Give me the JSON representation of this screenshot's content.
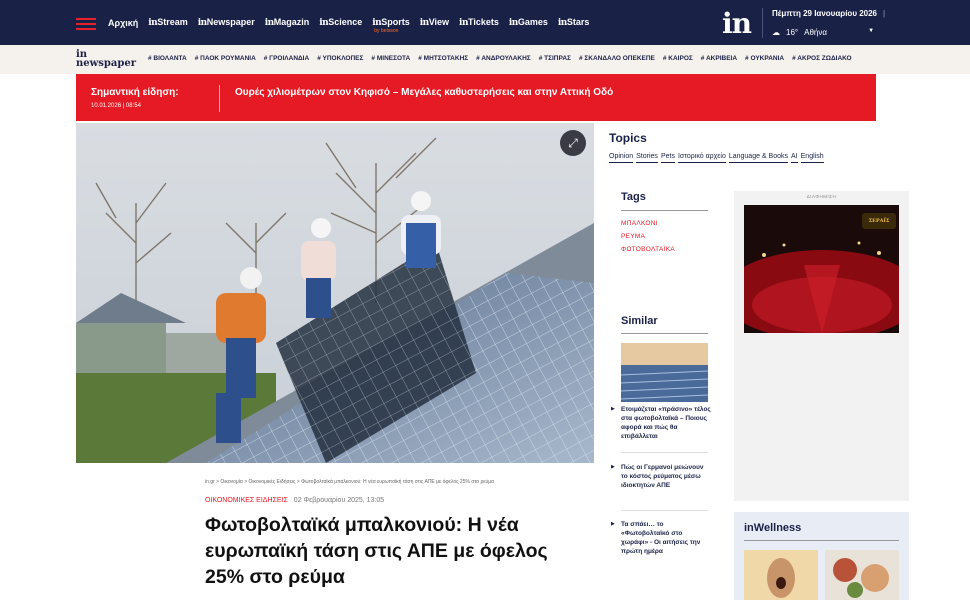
{
  "topnav": {
    "links": [
      {
        "prefix": "",
        "label": "Αρχική"
      },
      {
        "prefix": "in",
        "label": "Stream"
      },
      {
        "prefix": "in",
        "label": "Newspaper"
      },
      {
        "prefix": "in",
        "label": "Magazin"
      },
      {
        "prefix": "in",
        "label": "Science"
      },
      {
        "prefix": "in",
        "label": "Sports"
      },
      {
        "prefix": "in",
        "label": "View"
      },
      {
        "prefix": "in",
        "label": "Tickets"
      },
      {
        "prefix": "in",
        "label": "Games"
      },
      {
        "prefix": "in",
        "label": "Stars"
      }
    ],
    "sponsor": "by betsson",
    "logo": "in",
    "date": "Πέμπτη 29 Ιανουαρίου 2026",
    "date_sep": "|",
    "temperature": "16°",
    "city": "Αθήνα",
    "icons": {
      "menu": "hamburger-icon",
      "weather": "cloud-icon",
      "dropdown": "chevron-down-icon"
    }
  },
  "tagbar": {
    "brand_top": "in",
    "brand_bottom": "newspaper",
    "tags": [
      "# ΒΙΟΛΑΝΤΑ",
      "# ΠΑΟΚ ΡΟΥΜΑΝΙΑ",
      "# ΓΡΟΙΛΑΝΔΙΑ",
      "# ΥΠΟΚΛΟΠΕΣ",
      "# ΜΙΝΕΣΟΤΑ",
      "# ΜΗΤΣΟΤΑΚΗΣ",
      "# ΑΝΔΡΟΥΛΑΚΗΣ",
      "# ΤΣΙΠΡΑΣ",
      "# ΣΚΑΝΔΑΛΟ ΟΠΕΚΕΠΕ",
      "# ΚΑΙΡΟΣ",
      "# ΑΚΡΙΒΕΙΑ",
      "# ΟΥΚΡΑΝΙΑ",
      "# ΑΚΡΟΣ ΖΩΔΙΑΚΟ"
    ]
  },
  "breaking": {
    "label": "Σημαντική είδηση:",
    "time": "10.01.2026 | 08:54",
    "headline": "Ουρές χιλιομέτρων στον Κηφισό – Μεγάλες καθυστερήσεις και στην Αττική Οδό"
  },
  "article": {
    "breadcrumb": "in.gr > Οικονομία > Οικονομικές Ειδήσεις > Φωτοβολταϊκά μπαλκονιού: Η νέα ευρωπαϊκή τάση στις ΑΠΕ με όφελος 25% στο ρεύμα",
    "category": "ΟΙΚΟΝΟΜΙΚΕΣ ΕΙΔΗΣΕΙΣ",
    "date": "02 Φεβρουαρίου 2025, 13:05",
    "title": "Φωτοβολταϊκά μπαλκονιού: Η νέα ευρωπαϊκή τάση στις ΑΠΕ με όφελος 25% στο ρεύμα"
  },
  "topics": {
    "heading": "Topics",
    "items": [
      "Opinion",
      "Stories",
      "Pets",
      "Ιστορικό αρχείο",
      "Language & Books",
      "AI",
      "English"
    ]
  },
  "tags": {
    "heading": "Tags",
    "items": [
      "ΜΠΑΛΚΟΝΙ",
      "ΡΕΥΜΑ",
      "ΦΩΤΟΒΟΛΤΑΪΚΑ"
    ]
  },
  "similar": {
    "heading": "Similar",
    "items": [
      "Ετοιμάζεται «πράσινο» τέλος στα φωτοβολταϊκά – Ποιους αφορά και πώς θα επιβάλλεται",
      "Πώς οι Γερμανοί μειώνουν το κόστος ρεύματος μέσω ιδιοκτητών ΑΠΕ",
      "Τα σπάει… το «Φωτοβολταϊκό στο χωράφι» - Οι αιτήσεις την πρώτη ημέρα"
    ]
  },
  "ad": {
    "label": "ΔΙΑΦΗΜΙΣΗ",
    "logo_text": "ΣΕΡΑΪΣ"
  },
  "wellness": {
    "heading": "inWellness"
  },
  "colors": {
    "navy": "#1a2147",
    "red": "#e51a24",
    "cream": "#f5f1ec"
  }
}
